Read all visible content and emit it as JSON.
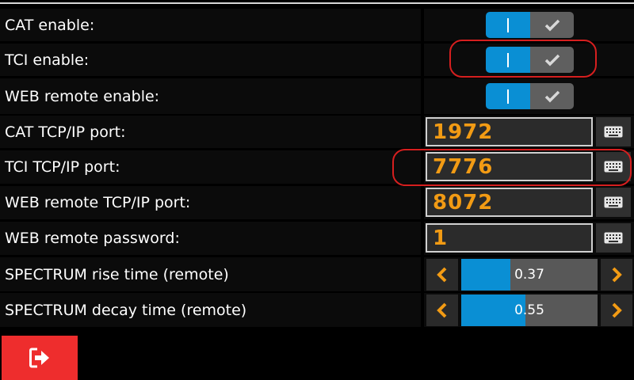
{
  "settings": {
    "cat_enable": {
      "label": "CAT enable:",
      "enabled": true
    },
    "tci_enable": {
      "label": "TCI enable:",
      "enabled": true
    },
    "web_enable": {
      "label": "WEB remote enable:",
      "enabled": true
    },
    "cat_port": {
      "label": "CAT TCP/IP port:",
      "value": "1972"
    },
    "tci_port": {
      "label": "TCI TCP/IP port:",
      "value": "7776"
    },
    "web_port": {
      "label": "WEB remote TCP/IP port:",
      "value": "8072"
    },
    "web_password": {
      "label": "WEB remote password:",
      "value": "1"
    },
    "spectrum_rise": {
      "label": "SPECTRUM rise time (remote)",
      "value": "0.37",
      "fill_fraction": 0.36
    },
    "spectrum_decay": {
      "label": "SPECTRUM decay time (remote)",
      "value": "0.55",
      "fill_fraction": 0.47
    }
  },
  "icons": {
    "toggle_check": "check-icon",
    "keyboard": "keyboard-icon",
    "left": "chevron-left-icon",
    "right": "chevron-right-icon",
    "exit": "exit-icon"
  },
  "colors": {
    "accent_blue": "#0a8fd4",
    "value_orange": "#f29b14",
    "highlight_red": "#d61f1f",
    "exit_red": "#ee2d2d"
  }
}
